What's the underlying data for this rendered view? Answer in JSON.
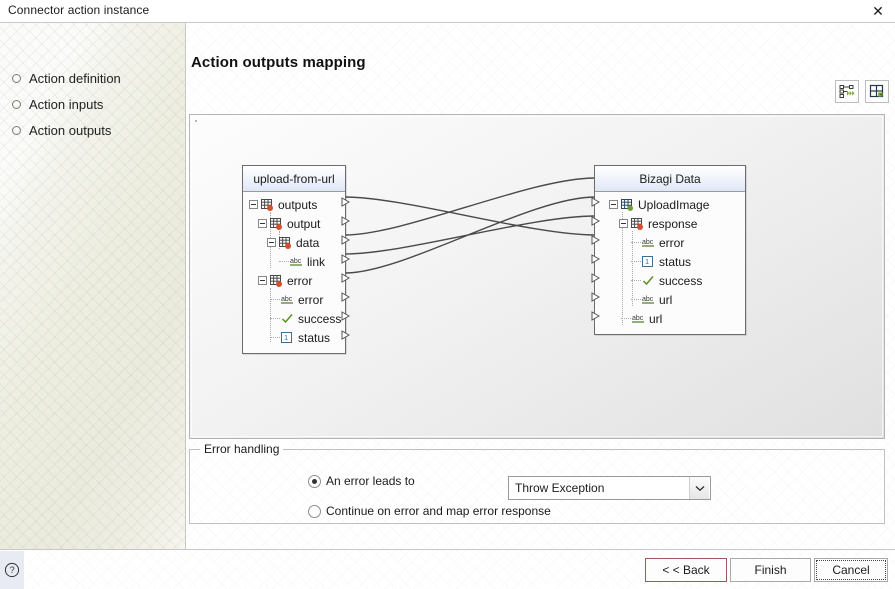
{
  "window": {
    "title": "Connector action instance",
    "close_label": "✕"
  },
  "sidebar": {
    "items": [
      {
        "label": "Action definition",
        "name": "action-definition"
      },
      {
        "label": "Action inputs",
        "name": "action-inputs"
      },
      {
        "label": "Action outputs",
        "name": "action-outputs"
      }
    ]
  },
  "main": {
    "page_title": "Action outputs mapping",
    "toolbar": [
      {
        "name": "auto-map-icon",
        "tooltip": "Auto map"
      },
      {
        "name": "arrange-layout-icon",
        "tooltip": "Arrange layout"
      }
    ]
  },
  "mapping": {
    "source_panel": {
      "title": "upload-from-url",
      "nodes": [
        {
          "label": "outputs",
          "depth": 0,
          "icon": "collection-icon",
          "expander": true,
          "connected": false
        },
        {
          "label": "output",
          "depth": 1,
          "icon": "collection-icon",
          "expander": true,
          "connected": false
        },
        {
          "label": "data",
          "depth": 2,
          "icon": "collection-icon",
          "expander": true,
          "connected": false
        },
        {
          "label": "link",
          "depth": 3,
          "icon": "abc-icon",
          "expander": false,
          "connected": true
        },
        {
          "label": "error",
          "depth": 1,
          "icon": "collection-icon",
          "expander": true,
          "connected": false
        },
        {
          "label": "error",
          "depth": 2,
          "icon": "abc-icon",
          "expander": false,
          "connected": true
        },
        {
          "label": "success",
          "depth": 2,
          "icon": "check-icon",
          "expander": false,
          "connected": true
        },
        {
          "label": "status",
          "depth": 2,
          "icon": "number-icon",
          "expander": false,
          "connected": true
        }
      ]
    },
    "target_panel": {
      "title": "Bizagi Data",
      "nodes": [
        {
          "label": "UploadImage",
          "depth": 0,
          "icon": "entity-icon",
          "expander": true,
          "connected": false
        },
        {
          "label": "response",
          "depth": 1,
          "icon": "collection-icon",
          "expander": true,
          "connected": false
        },
        {
          "label": "error",
          "depth": 2,
          "icon": "abc-icon",
          "expander": false,
          "connected": true
        },
        {
          "label": "status",
          "depth": 2,
          "icon": "number-icon",
          "expander": false,
          "connected": true
        },
        {
          "label": "success",
          "depth": 2,
          "icon": "check-icon",
          "expander": false,
          "connected": true
        },
        {
          "label": "url",
          "depth": 2,
          "icon": "abc-icon",
          "expander": false,
          "connected": true
        },
        {
          "label": "url",
          "depth": 1,
          "icon": "abc-icon",
          "expander": false,
          "connected": false
        }
      ]
    },
    "links": [
      {
        "from": "link",
        "to": "url",
        "from_index": 3,
        "to_index": 5
      },
      {
        "from": "error",
        "to": "error",
        "from_index": 5,
        "to_index": 2
      },
      {
        "from": "success",
        "to": "success",
        "from_index": 6,
        "to_index": 4
      },
      {
        "from": "status",
        "to": "status",
        "from_index": 7,
        "to_index": 3
      }
    ]
  },
  "error_handling": {
    "group_title": "Error handling",
    "option_leads_to": "An error leads to",
    "option_continue": "Continue on error and map error response",
    "selected_option": "An error leads to",
    "dropdown_value": "Throw Exception",
    "dropdown_options": [
      "Throw Exception"
    ]
  },
  "footer": {
    "help_label": "?",
    "back_label": "< < Back",
    "finish_label": "Finish",
    "cancel_label": "Cancel"
  },
  "colors": {
    "accent_green": "#6f9e2f",
    "panel_header": "#dfe8f6",
    "border": "#6c6c6c"
  }
}
